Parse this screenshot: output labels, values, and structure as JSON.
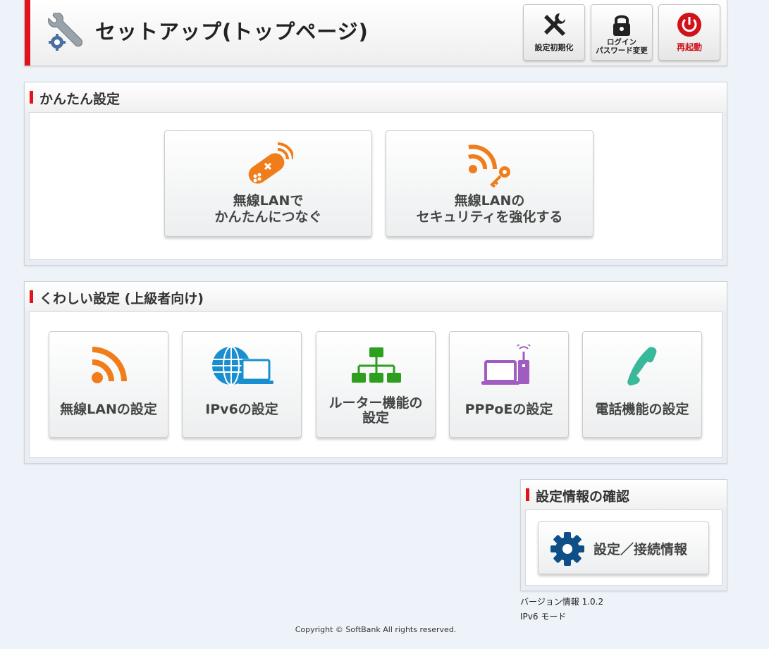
{
  "header": {
    "title": "セットアップ(トップページ)",
    "buttons": {
      "reset_label": "設定初期化",
      "password_label_1": "ログイン",
      "password_label_2": "パスワード変更",
      "reboot_label": "再起動"
    }
  },
  "easy_setup": {
    "title": "かんたん設定",
    "items": [
      {
        "line1": "無線LANで",
        "line2": "かんたんにつなぐ",
        "icon": "remote-wifi-icon"
      },
      {
        "line1": "無線LANの",
        "line2": "セキュリティを強化する",
        "icon": "wifi-key-icon"
      }
    ]
  },
  "advanced_setup": {
    "title": "くわしい設定 (上級者向け)",
    "items": [
      {
        "label": "無線LANの設定",
        "icon": "wifi-icon"
      },
      {
        "label": "IPv6の設定",
        "icon": "globe-laptop-icon"
      },
      {
        "line1": "ルーター機能の",
        "line2": "設定",
        "icon": "network-tree-icon"
      },
      {
        "label": "PPPoEの設定",
        "icon": "laptop-router-icon"
      },
      {
        "label": "電話機能の設定",
        "icon": "phone-icon"
      }
    ]
  },
  "info_section": {
    "title": "設定情報の確認",
    "button_label": "設定／接続情報",
    "version_text": "バージョン情報  1.0.2",
    "mode_text": "IPv6  モード"
  },
  "footer": {
    "copyright": "Copyright © SoftBank All rights reserved."
  },
  "colors": {
    "accent_red": "#e0141e",
    "orange": "#f07d1a",
    "blue": "#1a8fd0",
    "green": "#2e9e1e",
    "purple": "#a05cc0",
    "teal": "#3ab89a",
    "navy": "#0d4f86"
  }
}
